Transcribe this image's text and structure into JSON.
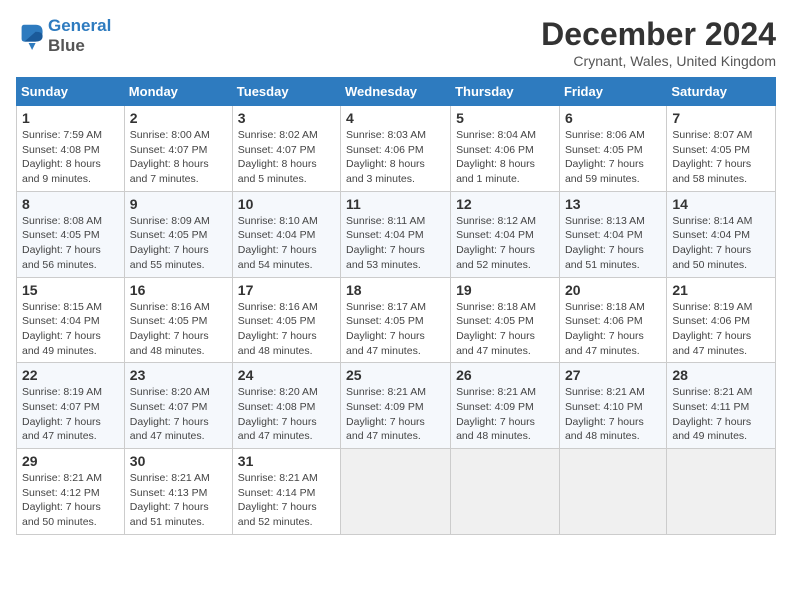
{
  "logo": {
    "line1": "General",
    "line2": "Blue"
  },
  "title": "December 2024",
  "location": "Crynant, Wales, United Kingdom",
  "days_of_week": [
    "Sunday",
    "Monday",
    "Tuesday",
    "Wednesday",
    "Thursday",
    "Friday",
    "Saturday"
  ],
  "weeks": [
    [
      {
        "num": "1",
        "info": "Sunrise: 7:59 AM\nSunset: 4:08 PM\nDaylight: 8 hours\nand 9 minutes."
      },
      {
        "num": "2",
        "info": "Sunrise: 8:00 AM\nSunset: 4:07 PM\nDaylight: 8 hours\nand 7 minutes."
      },
      {
        "num": "3",
        "info": "Sunrise: 8:02 AM\nSunset: 4:07 PM\nDaylight: 8 hours\nand 5 minutes."
      },
      {
        "num": "4",
        "info": "Sunrise: 8:03 AM\nSunset: 4:06 PM\nDaylight: 8 hours\nand 3 minutes."
      },
      {
        "num": "5",
        "info": "Sunrise: 8:04 AM\nSunset: 4:06 PM\nDaylight: 8 hours\nand 1 minute."
      },
      {
        "num": "6",
        "info": "Sunrise: 8:06 AM\nSunset: 4:05 PM\nDaylight: 7 hours\nand 59 minutes."
      },
      {
        "num": "7",
        "info": "Sunrise: 8:07 AM\nSunset: 4:05 PM\nDaylight: 7 hours\nand 58 minutes."
      }
    ],
    [
      {
        "num": "8",
        "info": "Sunrise: 8:08 AM\nSunset: 4:05 PM\nDaylight: 7 hours\nand 56 minutes."
      },
      {
        "num": "9",
        "info": "Sunrise: 8:09 AM\nSunset: 4:05 PM\nDaylight: 7 hours\nand 55 minutes."
      },
      {
        "num": "10",
        "info": "Sunrise: 8:10 AM\nSunset: 4:04 PM\nDaylight: 7 hours\nand 54 minutes."
      },
      {
        "num": "11",
        "info": "Sunrise: 8:11 AM\nSunset: 4:04 PM\nDaylight: 7 hours\nand 53 minutes."
      },
      {
        "num": "12",
        "info": "Sunrise: 8:12 AM\nSunset: 4:04 PM\nDaylight: 7 hours\nand 52 minutes."
      },
      {
        "num": "13",
        "info": "Sunrise: 8:13 AM\nSunset: 4:04 PM\nDaylight: 7 hours\nand 51 minutes."
      },
      {
        "num": "14",
        "info": "Sunrise: 8:14 AM\nSunset: 4:04 PM\nDaylight: 7 hours\nand 50 minutes."
      }
    ],
    [
      {
        "num": "15",
        "info": "Sunrise: 8:15 AM\nSunset: 4:04 PM\nDaylight: 7 hours\nand 49 minutes."
      },
      {
        "num": "16",
        "info": "Sunrise: 8:16 AM\nSunset: 4:05 PM\nDaylight: 7 hours\nand 48 minutes."
      },
      {
        "num": "17",
        "info": "Sunrise: 8:16 AM\nSunset: 4:05 PM\nDaylight: 7 hours\nand 48 minutes."
      },
      {
        "num": "18",
        "info": "Sunrise: 8:17 AM\nSunset: 4:05 PM\nDaylight: 7 hours\nand 47 minutes."
      },
      {
        "num": "19",
        "info": "Sunrise: 8:18 AM\nSunset: 4:05 PM\nDaylight: 7 hours\nand 47 minutes."
      },
      {
        "num": "20",
        "info": "Sunrise: 8:18 AM\nSunset: 4:06 PM\nDaylight: 7 hours\nand 47 minutes."
      },
      {
        "num": "21",
        "info": "Sunrise: 8:19 AM\nSunset: 4:06 PM\nDaylight: 7 hours\nand 47 minutes."
      }
    ],
    [
      {
        "num": "22",
        "info": "Sunrise: 8:19 AM\nSunset: 4:07 PM\nDaylight: 7 hours\nand 47 minutes."
      },
      {
        "num": "23",
        "info": "Sunrise: 8:20 AM\nSunset: 4:07 PM\nDaylight: 7 hours\nand 47 minutes."
      },
      {
        "num": "24",
        "info": "Sunrise: 8:20 AM\nSunset: 4:08 PM\nDaylight: 7 hours\nand 47 minutes."
      },
      {
        "num": "25",
        "info": "Sunrise: 8:21 AM\nSunset: 4:09 PM\nDaylight: 7 hours\nand 47 minutes."
      },
      {
        "num": "26",
        "info": "Sunrise: 8:21 AM\nSunset: 4:09 PM\nDaylight: 7 hours\nand 48 minutes."
      },
      {
        "num": "27",
        "info": "Sunrise: 8:21 AM\nSunset: 4:10 PM\nDaylight: 7 hours\nand 48 minutes."
      },
      {
        "num": "28",
        "info": "Sunrise: 8:21 AM\nSunset: 4:11 PM\nDaylight: 7 hours\nand 49 minutes."
      }
    ],
    [
      {
        "num": "29",
        "info": "Sunrise: 8:21 AM\nSunset: 4:12 PM\nDaylight: 7 hours\nand 50 minutes."
      },
      {
        "num": "30",
        "info": "Sunrise: 8:21 AM\nSunset: 4:13 PM\nDaylight: 7 hours\nand 51 minutes."
      },
      {
        "num": "31",
        "info": "Sunrise: 8:21 AM\nSunset: 4:14 PM\nDaylight: 7 hours\nand 52 minutes."
      },
      null,
      null,
      null,
      null
    ]
  ]
}
